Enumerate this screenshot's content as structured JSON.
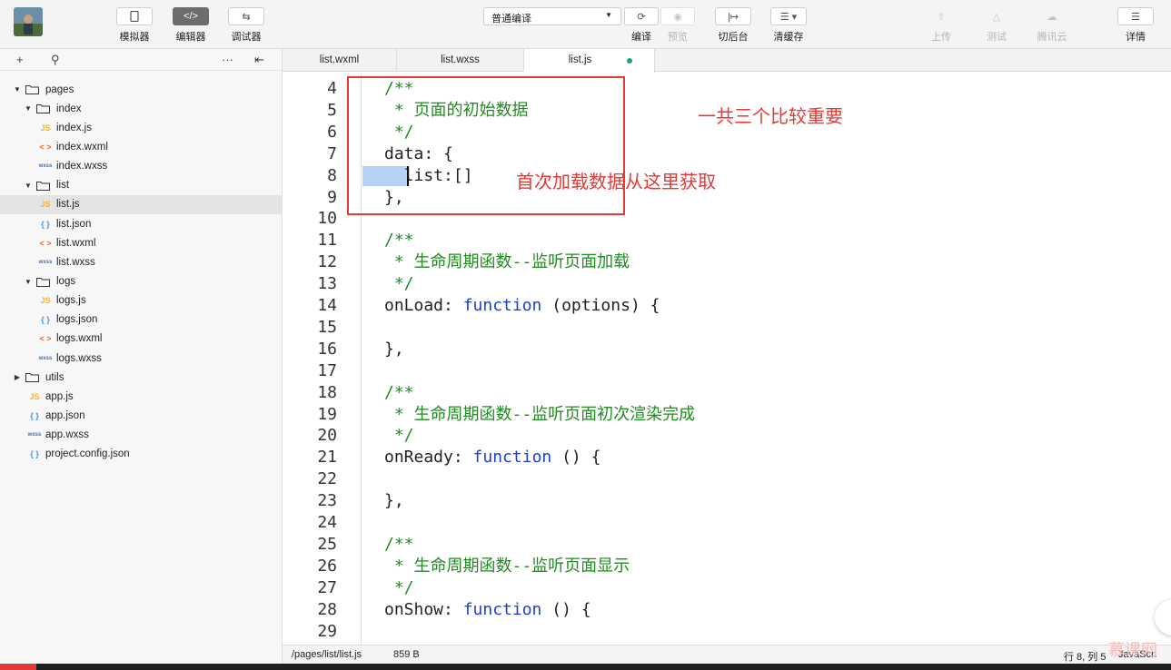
{
  "toolbar": {
    "simulator": "模拟器",
    "editor": "编辑器",
    "debugger": "调试器",
    "compile_mode": "普通编译",
    "compile": "编译",
    "preview": "预览",
    "background": "切后台",
    "clear_cache": "清缓存",
    "upload": "上传",
    "test": "测试",
    "tencent_cloud": "腾讯云",
    "details": "详情"
  },
  "sidebar": {
    "items": [
      {
        "label": "pages",
        "type": "folder",
        "open": true
      },
      {
        "label": "index",
        "type": "folder",
        "open": true
      },
      {
        "label": "index.js",
        "type": "js"
      },
      {
        "label": "index.wxml",
        "type": "wxml"
      },
      {
        "label": "index.wxss",
        "type": "wxss"
      },
      {
        "label": "list",
        "type": "folder",
        "open": true
      },
      {
        "label": "list.js",
        "type": "js",
        "selected": true
      },
      {
        "label": "list.json",
        "type": "json"
      },
      {
        "label": "list.wxml",
        "type": "wxml"
      },
      {
        "label": "list.wxss",
        "type": "wxss"
      },
      {
        "label": "logs",
        "type": "folder",
        "open": true
      },
      {
        "label": "logs.js",
        "type": "js"
      },
      {
        "label": "logs.json",
        "type": "json"
      },
      {
        "label": "logs.wxml",
        "type": "wxml"
      },
      {
        "label": "logs.wxss",
        "type": "wxss"
      },
      {
        "label": "utils",
        "type": "folder",
        "open": false
      },
      {
        "label": "app.js",
        "type": "js"
      },
      {
        "label": "app.json",
        "type": "json"
      },
      {
        "label": "app.wxss",
        "type": "wxss"
      },
      {
        "label": "project.config.json",
        "type": "json"
      }
    ],
    "file_badges": {
      "js": "JS",
      "json": "{ }",
      "wxml": "< >",
      "wxss": "wxss"
    }
  },
  "tabs": [
    {
      "label": "list.wxml"
    },
    {
      "label": "list.wxss"
    },
    {
      "label": "list.js",
      "active": true,
      "modified": true
    }
  ],
  "editor": {
    "lines": [
      {
        "n": "4",
        "text": "/**",
        "kind": "comment"
      },
      {
        "n": "5",
        "text": " * 页面的初始数据",
        "kind": "comment"
      },
      {
        "n": "6",
        "text": " */",
        "kind": "comment"
      },
      {
        "n": "7",
        "text": "data: {",
        "kind": "plain"
      },
      {
        "n": "8",
        "text": "  list:[]",
        "kind": "plain"
      },
      {
        "n": "9",
        "text": "},",
        "kind": "plain"
      },
      {
        "n": "10",
        "text": "",
        "kind": "plain"
      },
      {
        "n": "11",
        "text": "/**",
        "kind": "comment"
      },
      {
        "n": "12",
        "text": " * 生命周期函数--监听页面加载",
        "kind": "comment"
      },
      {
        "n": "13",
        "text": " */",
        "kind": "comment"
      },
      {
        "n": "14",
        "pre": "onLoad: ",
        "kw": "function",
        "post": " (options) {",
        "kind": "fn"
      },
      {
        "n": "15",
        "text": "",
        "kind": "plain"
      },
      {
        "n": "16",
        "text": "},",
        "kind": "plain"
      },
      {
        "n": "17",
        "text": "",
        "kind": "plain"
      },
      {
        "n": "18",
        "text": "/**",
        "kind": "comment"
      },
      {
        "n": "19",
        "text": " * 生命周期函数--监听页面初次渲染完成",
        "kind": "comment"
      },
      {
        "n": "20",
        "text": " */",
        "kind": "comment"
      },
      {
        "n": "21",
        "pre": "onReady: ",
        "kw": "function",
        "post": " () {",
        "kind": "fn"
      },
      {
        "n": "22",
        "text": "",
        "kind": "plain"
      },
      {
        "n": "23",
        "text": "},",
        "kind": "plain"
      },
      {
        "n": "24",
        "text": "",
        "kind": "plain"
      },
      {
        "n": "25",
        "text": "/**",
        "kind": "comment"
      },
      {
        "n": "26",
        "text": " * 生命周期函数--监听页面显示",
        "kind": "comment"
      },
      {
        "n": "27",
        "text": " */",
        "kind": "comment"
      },
      {
        "n": "28",
        "pre": "onShow: ",
        "kw": "function",
        "post": " () {",
        "kind": "fn"
      },
      {
        "n": "29",
        "text": "",
        "kind": "plain"
      }
    ]
  },
  "annotations": {
    "note1": "一共三个比较重要",
    "note2": "首次加载数据从这里获取"
  },
  "status": {
    "path": "/pages/list/list.js",
    "size": "859 B",
    "position": "行 8, 列 5",
    "language": "JavaScri"
  },
  "watermark": "慕课网",
  "colors": {
    "comment": "#228b22",
    "keyword": "#1a3fd1",
    "annotation": "#e53935",
    "modified_dot": "#17a589"
  }
}
